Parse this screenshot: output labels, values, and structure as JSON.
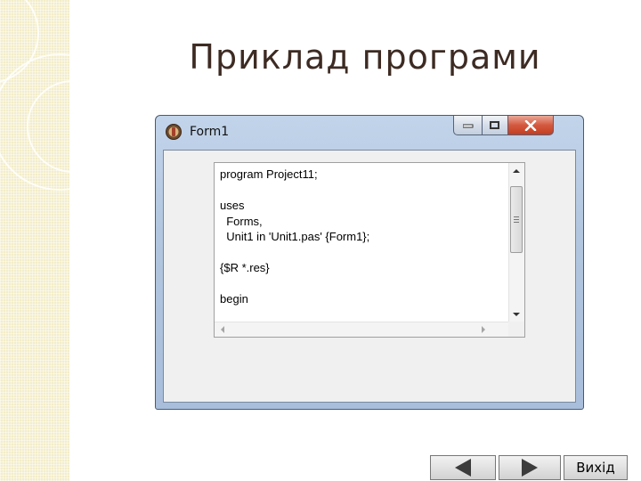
{
  "slide": {
    "title": "Приклад програми"
  },
  "window": {
    "title": "Form1",
    "icon": "delphi-app-icon",
    "buttons": {
      "minimize_icon": "minimize-icon",
      "maximize_icon": "maximize-icon",
      "close_icon": "close-icon"
    }
  },
  "memo": {
    "lines": [
      "program Project11;",
      "",
      "uses",
      "  Forms,",
      "  Unit1 in 'Unit1.pas' {Form1};",
      "",
      "{$R *.res}",
      "",
      "begin"
    ]
  },
  "navigation": {
    "prev_icon": "triangle-left-icon",
    "next_icon": "triangle-right-icon",
    "exit_label": "Вихід"
  },
  "colors": {
    "title_text": "#3d2b23",
    "close_button": "#c33d20",
    "sidebar": "#f3edc9"
  }
}
